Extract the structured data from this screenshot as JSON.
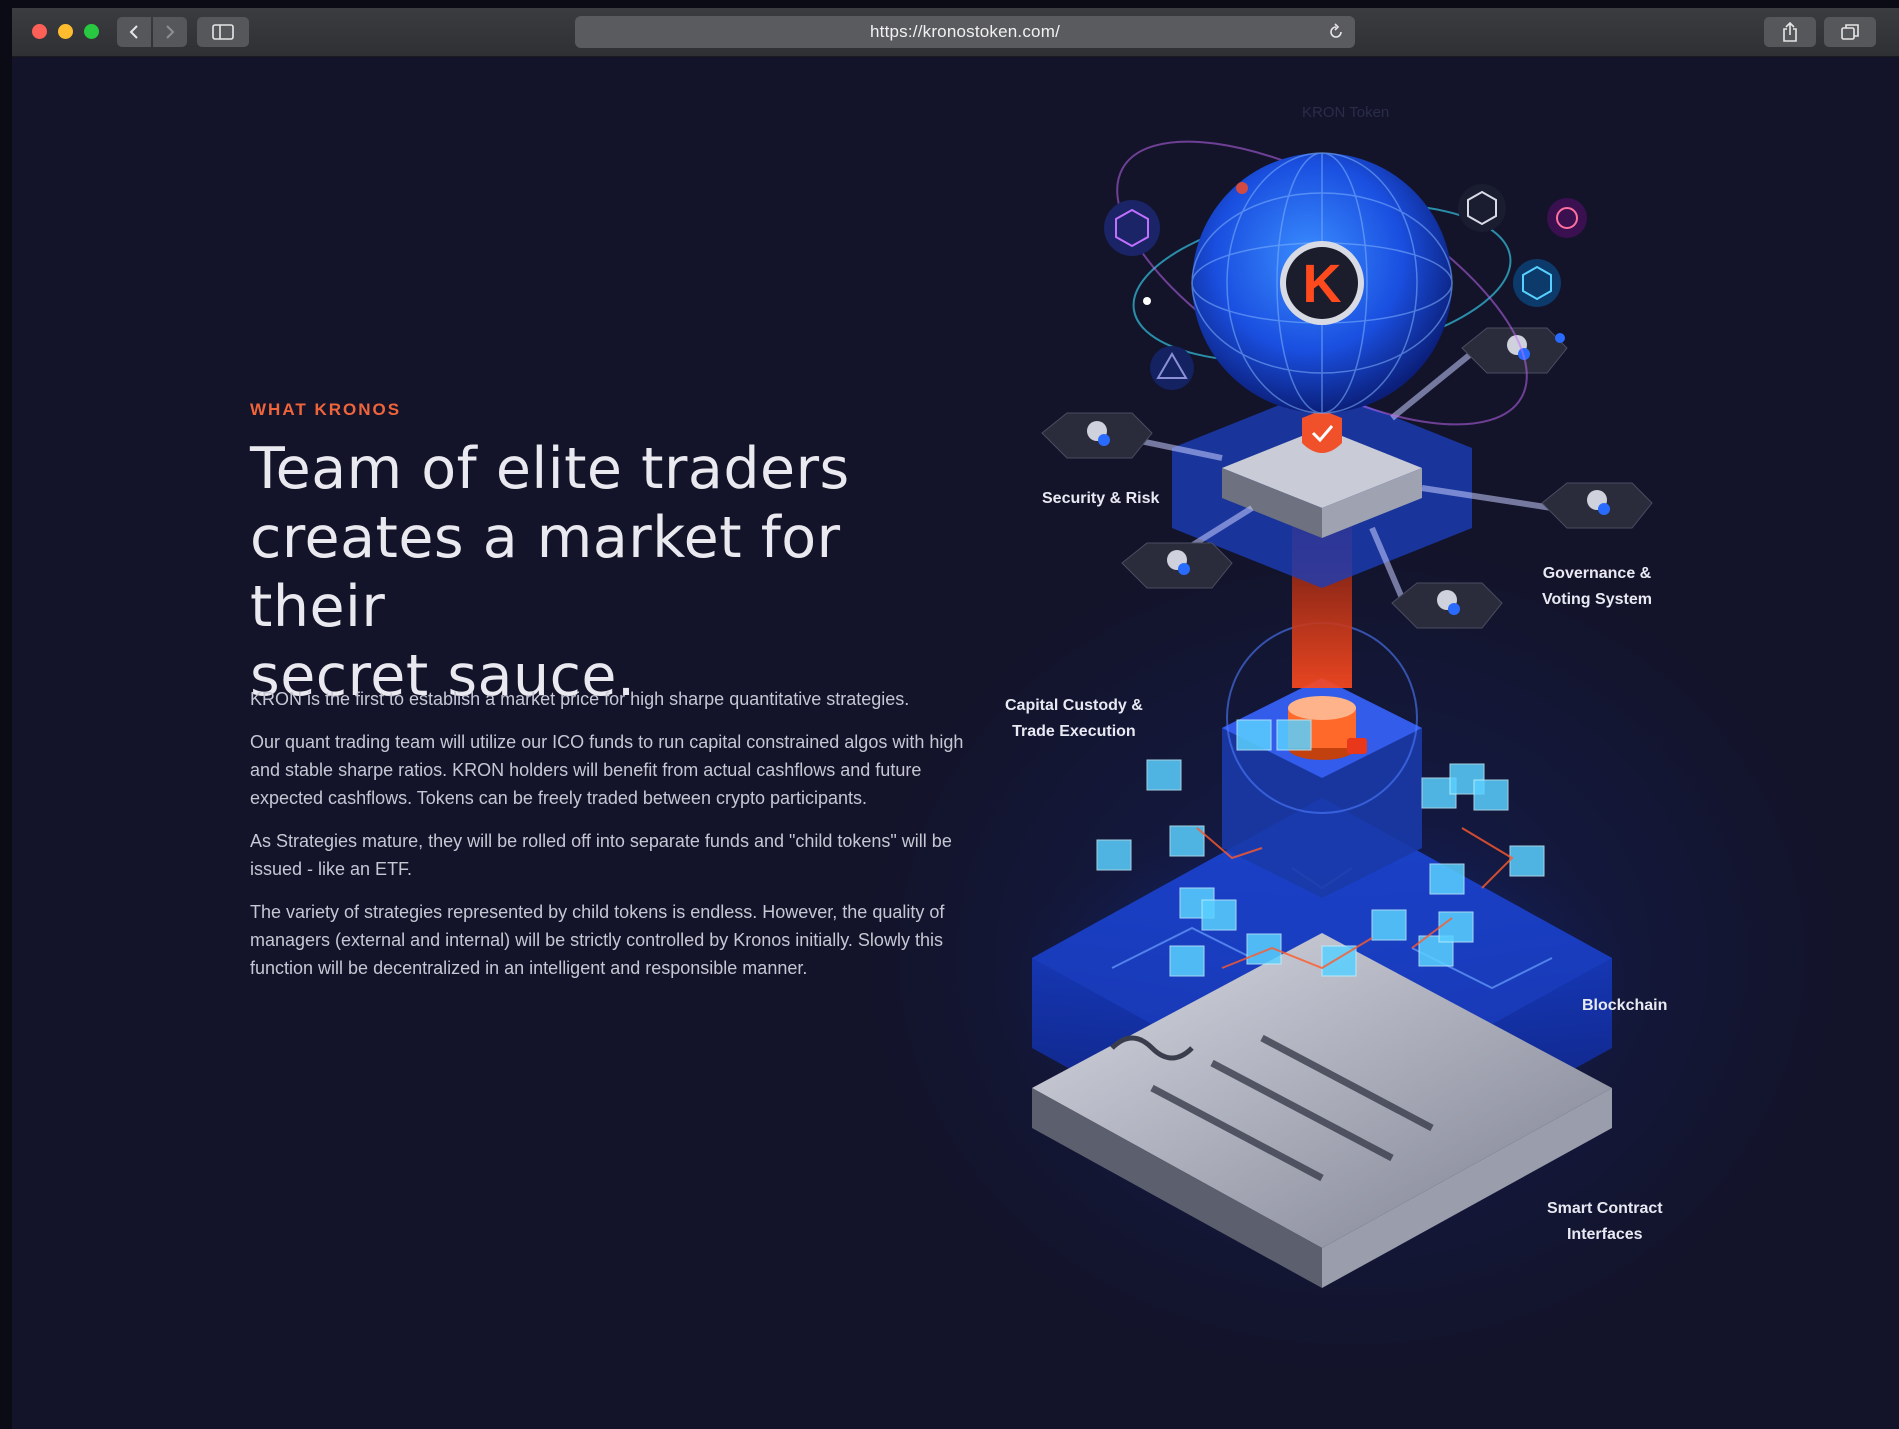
{
  "browser": {
    "url": "https://kronostoken.com/",
    "icons": {
      "back": "chevron-left-icon",
      "forward": "chevron-right-icon",
      "sidebar": "sidebar-icon",
      "reload": "reload-icon",
      "share": "share-icon",
      "tabs": "tabs-icon"
    }
  },
  "section": {
    "eyebrow": "WHAT KRONOS",
    "headline_lines": [
      "Team of elite traders",
      "creates a market for their",
      "secret sauce."
    ],
    "paragraphs": [
      "KRON is the first to establish a market price for high sharpe quantitative strategies.",
      "Our quant trading team will utilize our ICO funds to run capital constrained algos with high and stable sharpe ratios. KRON holders will benefit from actual cashflows and future expected cashflows. Tokens can be freely traded between crypto participants.",
      "As Strategies mature, they will be rolled off into separate funds and \"child tokens\" will be issued - like an ETF.",
      "The variety of strategies represented by child tokens is endless. However, the quality of managers (external and internal) will be strictly controlled by Kronos initially. Slowly this function will be decentralized in an intelligent and responsible manner."
    ]
  },
  "illustration": {
    "kron_token_label": "KRON Token",
    "logo_letter": "K",
    "security_label": "Security & Risk",
    "governance_label": [
      "Governance &",
      "Voting System"
    ],
    "custody_label": [
      "Capital Custody &",
      "Trade Execution"
    ],
    "blockchain_label": "Blockchain",
    "smart_contract_label": [
      "Smart Contract",
      "Interfaces"
    ]
  },
  "colors": {
    "accent": "#f0643a",
    "background": "#13142a",
    "glow_blue": "#1f5cff"
  }
}
